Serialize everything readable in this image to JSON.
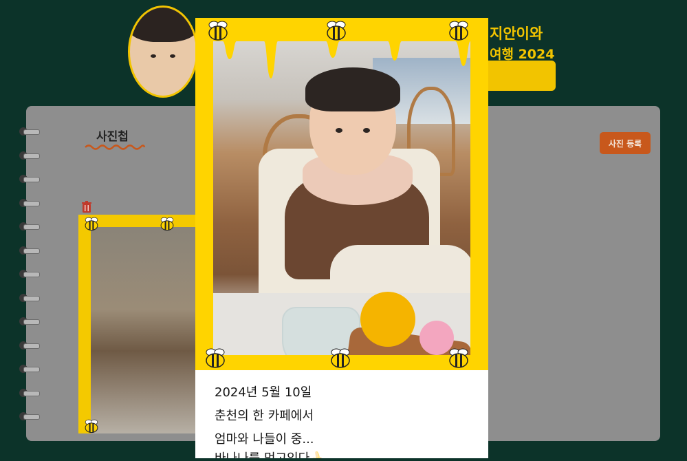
{
  "header": {
    "title_line1": "지안이와",
    "title_line2": "여행 2024",
    "button_label": ""
  },
  "album": {
    "title": "사진첩",
    "register_button": "사진 등록"
  },
  "modal": {
    "caption_lines": [
      "2024년 5월 10일",
      "춘천의 한 카페에서",
      "엄마와 나들이 중...",
      "바나나를 먹고있다🍌"
    ]
  },
  "colors": {
    "background": "#0c3329",
    "accent_yellow": "#ffd400",
    "register_button": "#c8581c",
    "panel": "#8e8e8e"
  },
  "icons": [
    "bee-icon",
    "trash-icon",
    "banana-emoji"
  ]
}
